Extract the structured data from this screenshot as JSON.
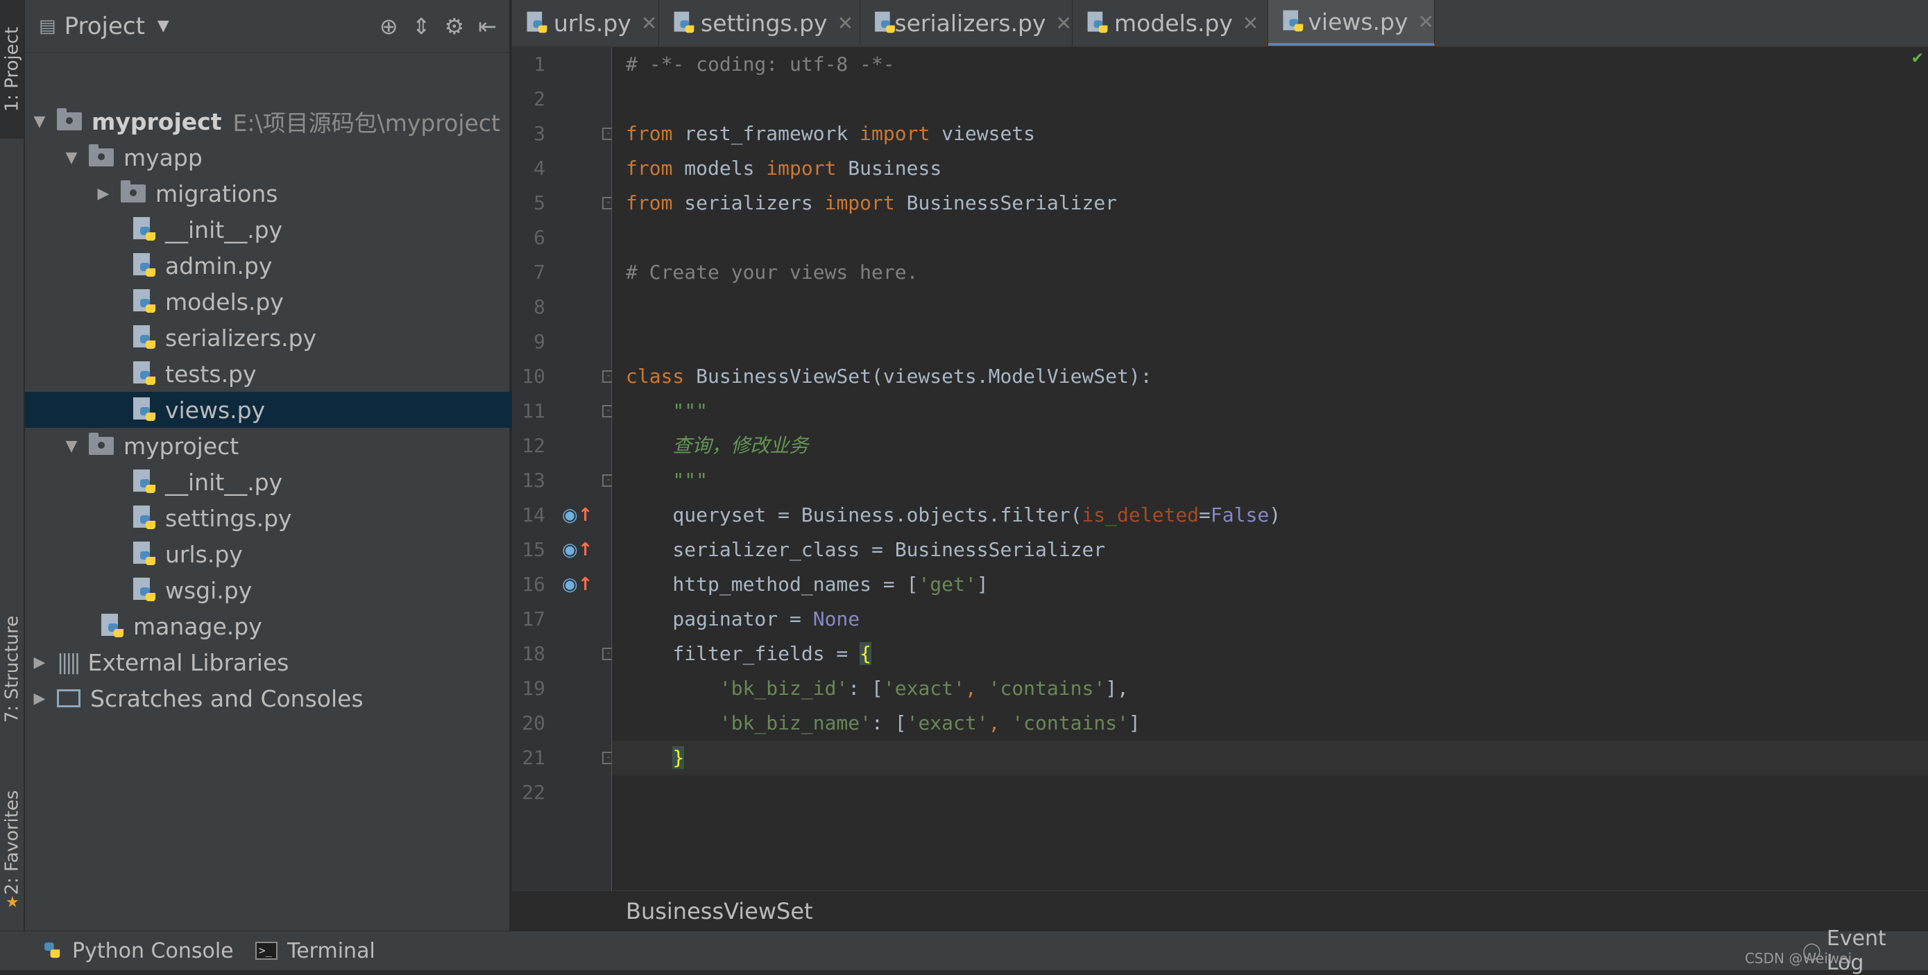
{
  "left_strip": {
    "project_tab": "1: Project",
    "structure_tab": "7: Structure",
    "favorites_tab": "2: Favorites"
  },
  "project_panel": {
    "title": "Project",
    "tree": [
      {
        "label": "myproject",
        "path": "E:\\项目源码包\\myproject",
        "kind": "root"
      },
      {
        "label": "myapp",
        "kind": "folder"
      },
      {
        "label": "migrations",
        "kind": "folder"
      },
      {
        "label": "__init__.py",
        "kind": "py"
      },
      {
        "label": "admin.py",
        "kind": "py"
      },
      {
        "label": "models.py",
        "kind": "py"
      },
      {
        "label": "serializers.py",
        "kind": "py"
      },
      {
        "label": "tests.py",
        "kind": "py"
      },
      {
        "label": "views.py",
        "kind": "py",
        "selected": true
      },
      {
        "label": "myproject",
        "kind": "folder"
      },
      {
        "label": "__init__.py",
        "kind": "py"
      },
      {
        "label": "settings.py",
        "kind": "py"
      },
      {
        "label": "urls.py",
        "kind": "py"
      },
      {
        "label": "wsgi.py",
        "kind": "py"
      },
      {
        "label": "manage.py",
        "kind": "py"
      },
      {
        "label": "External Libraries",
        "kind": "libs"
      },
      {
        "label": "Scratches and Consoles",
        "kind": "scratch"
      }
    ]
  },
  "tabs": [
    {
      "label": "urls.py"
    },
    {
      "label": "settings.py"
    },
    {
      "label": "serializers.py"
    },
    {
      "label": "models.py"
    },
    {
      "label": "views.py",
      "active": true
    }
  ],
  "editor": {
    "lines": [
      "1",
      "2",
      "3",
      "4",
      "5",
      "6",
      "7",
      "8",
      "9",
      "10",
      "11",
      "12",
      "13",
      "14",
      "15",
      "16",
      "17",
      "18",
      "19",
      "20",
      "21",
      "22"
    ],
    "code": {
      "l1": "# -*- coding: utf-8 -*-",
      "l3_from": "from",
      "l3_mod": " rest_framework ",
      "l3_import": "import",
      "l3_name": " viewsets",
      "l4_from": "from",
      "l4_mod": " models ",
      "l4_import": "import",
      "l4_name": " Business",
      "l5_from": "from",
      "l5_mod": " serializers ",
      "l5_import": "import",
      "l5_name": " BusinessSerializer",
      "l7": "# Create your views here.",
      "l10_class": "class",
      "l10_rest": " BusinessViewSet(viewsets.ModelViewSet):",
      "l11": "    \"\"\"",
      "l12": "    查询，修改业务",
      "l13": "    \"\"\"",
      "l14_a": "    queryset = Business.objects.filter(",
      "l14_param": "is_deleted",
      "l14_eq": "=",
      "l14_const": "False",
      "l14_end": ")",
      "l15": "    serializer_class = BusinessSerializer",
      "l16_a": "    http_method_names = [",
      "l16_str": "'get'",
      "l16_end": "]",
      "l17_a": "    paginator = ",
      "l17_const": "None",
      "l18_a": "    filter_fields = ",
      "l18_brace": "{",
      "l19_indent": "        ",
      "l19_key": "'bk_biz_id'",
      "l19_colon": ": [",
      "l19_s1": "'exact'",
      "l19_comma": ", ",
      "l19_s2": "'contains'",
      "l19_end": "],",
      "l20_indent": "        ",
      "l20_key": "'bk_biz_name'",
      "l20_colon": ": [",
      "l20_s1": "'exact'",
      "l20_comma": ", ",
      "l20_s2": "'contains'",
      "l20_end": "]",
      "l21_indent": "    ",
      "l21_brace": "}"
    },
    "breadcrumb": "BusinessViewSet"
  },
  "bottom_bar": {
    "python_console": "Python Console",
    "terminal": "Terminal",
    "event_log": "Event Log",
    "watermark": "CSDN @Weiwei"
  },
  "colors": {
    "keyword": "#cc7832",
    "string": "#6a8759",
    "comment": "#808080",
    "docstring": "#629755",
    "selection": "#0d293e",
    "tab_accent": "#4a88c7"
  }
}
